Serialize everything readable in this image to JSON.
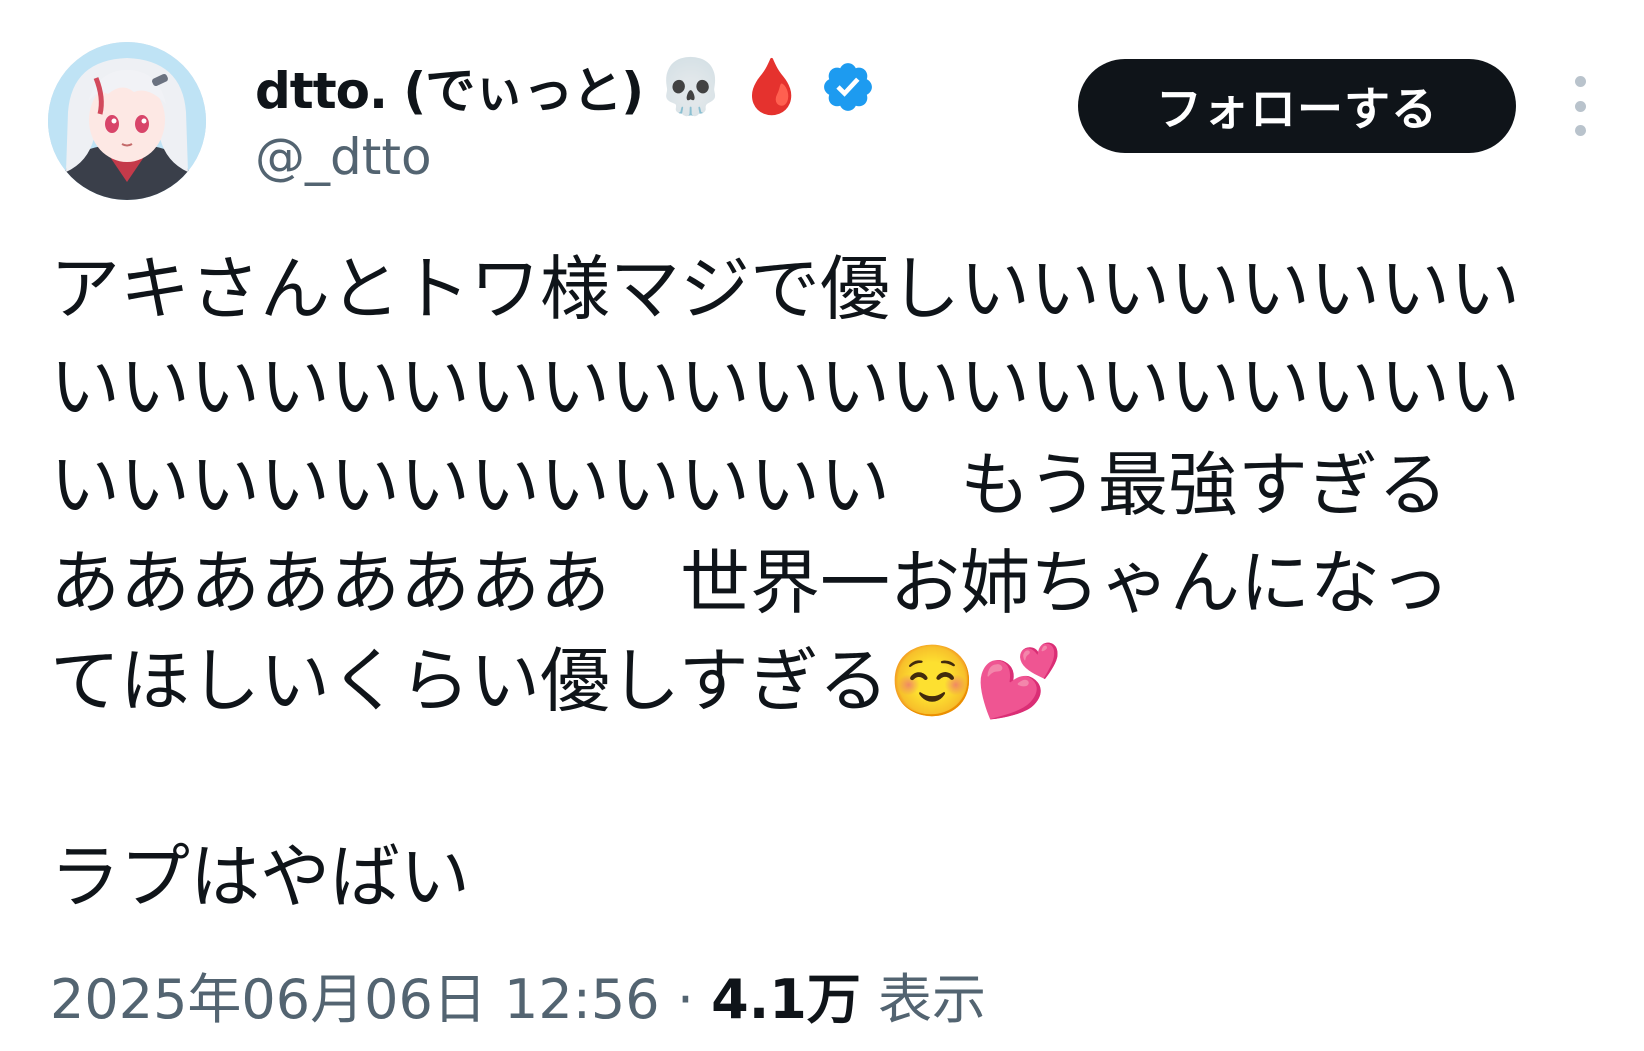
{
  "author": {
    "display_name": "dtto. (でぃっと)",
    "name_emojis": [
      "💀",
      "🩸"
    ],
    "verified_icon": "verified-badge-icon",
    "handle": "@_dtto"
  },
  "actions": {
    "follow_label": "フォローする",
    "more_icon": "more-vertical-icon"
  },
  "tweet": {
    "lines": [
      "アキさんとトワ様マジで優しいいいいいいいい",
      "いいいいいいいいいいいいいいいいいいいいい",
      "いいいいいいいいいいいい　もう最強すぎる",
      "ああああああああ　世界一お姉ちゃんになっ",
      "てほしいくらい優しすぎる☺️💕",
      "",
      "ラプはやばい"
    ]
  },
  "meta": {
    "timestamp": "2025年06月06日 12:56",
    "separator": "·",
    "views_count": "4.1万",
    "views_label": "表示"
  },
  "colors": {
    "text": "#0f1419",
    "secondary": "#536471",
    "verified": "#1d9bf0",
    "button_bg": "#0f1419"
  }
}
